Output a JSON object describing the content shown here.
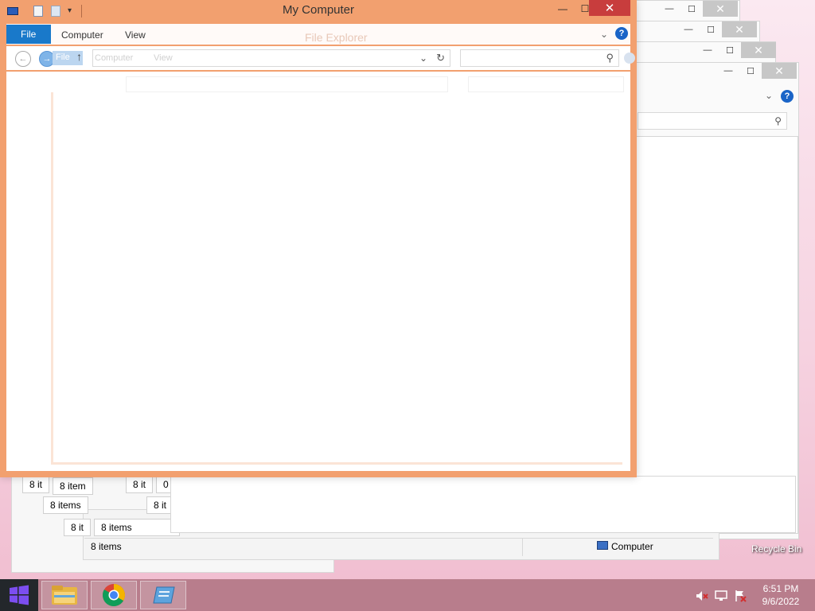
{
  "main_window": {
    "title": "My Computer",
    "ribbon_tabs": [
      "File",
      "Computer",
      "View"
    ],
    "help_label": "?",
    "ghost_title": "File Explorer",
    "ghost_tabs": [
      "File",
      "Computer",
      "View"
    ]
  },
  "caption": {
    "minimize": "—",
    "maximize": "☐",
    "close": "✕"
  },
  "background_windows": {
    "status_items": [
      "8 it",
      "8 item",
      "8 items",
      "8 it",
      "8 it",
      "8 items",
      "8 it",
      "0",
      "8 items"
    ],
    "computer_label": "Computer"
  },
  "desktop": {
    "recycle_bin_label": "Recycle Bin"
  },
  "taskbar": {
    "time": "6:51 PM",
    "date": "9/6/2022",
    "apps": [
      "file-explorer",
      "chrome",
      "server-manager"
    ]
  },
  "colors": {
    "active_border": "#f2a06f",
    "ribbon_file_tab": "#1979ca",
    "close_button": "#c83d3d"
  }
}
